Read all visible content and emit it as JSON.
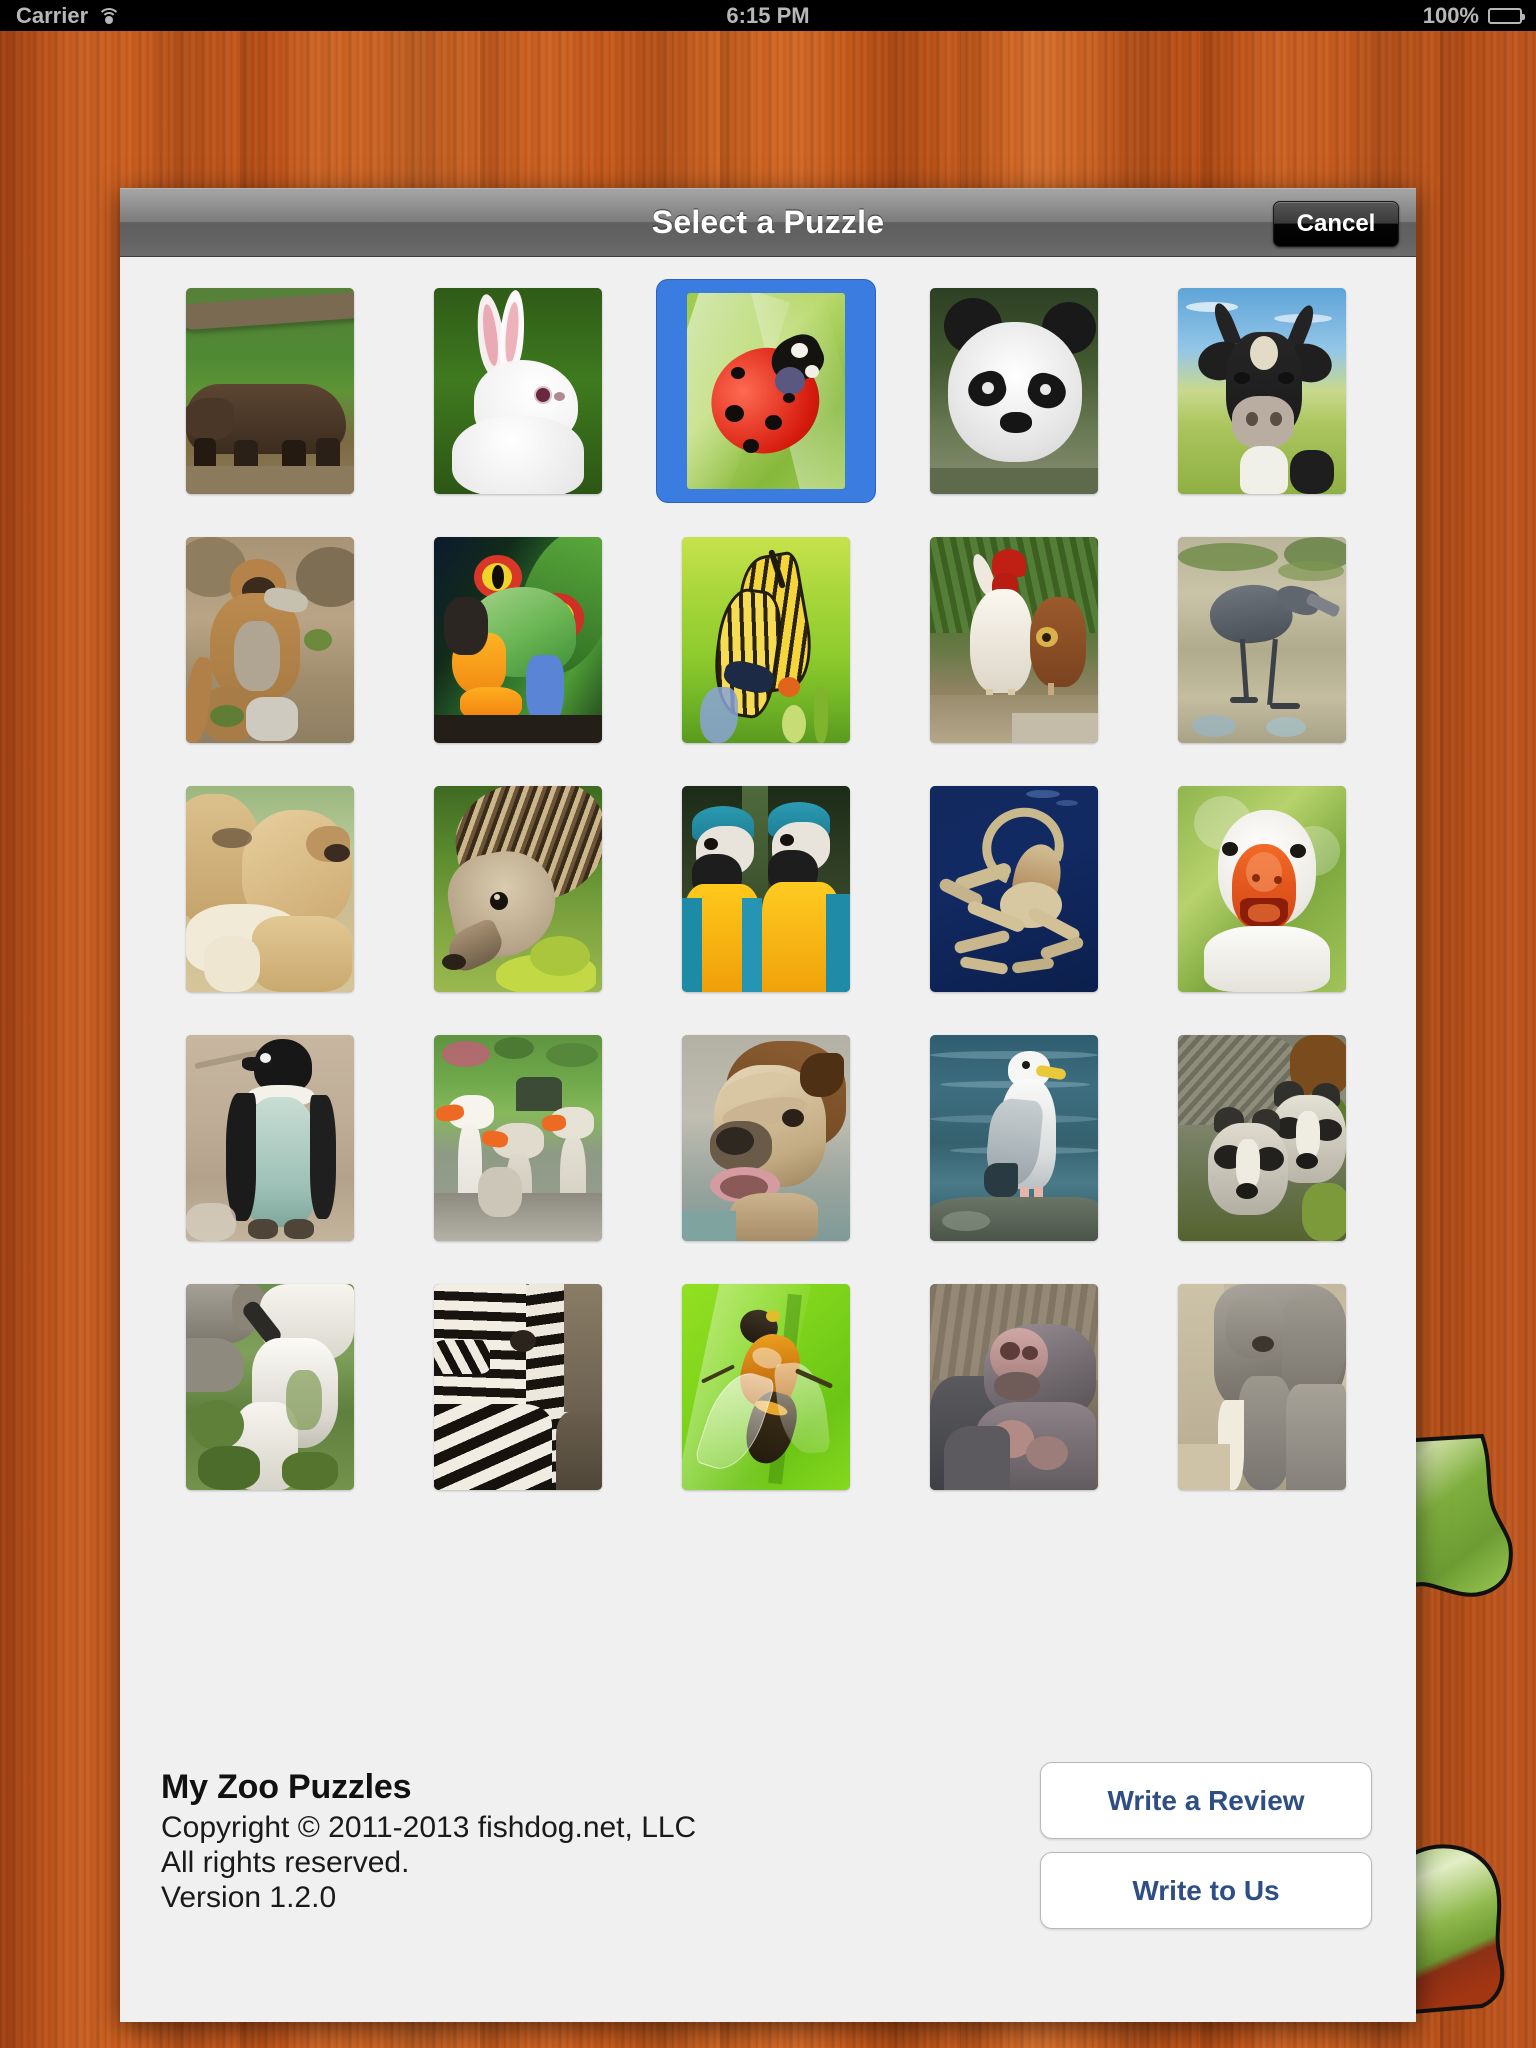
{
  "status_bar": {
    "carrier": "Carrier",
    "wifi_icon": "wifi-icon",
    "time": "6:15 PM",
    "battery_percent": "100%",
    "battery_icon": "battery-full-icon"
  },
  "modal": {
    "title": "Select a Puzzle",
    "cancel_label": "Cancel"
  },
  "grid": {
    "columns": 5,
    "rows": 5,
    "selected_index": 2,
    "items": [
      {
        "name": "bear",
        "label": "Bear"
      },
      {
        "name": "rabbit",
        "label": "Rabbit"
      },
      {
        "name": "ladybug",
        "label": "Ladybug"
      },
      {
        "name": "panda",
        "label": "Panda"
      },
      {
        "name": "cow",
        "label": "Cow"
      },
      {
        "name": "monkey",
        "label": "Monkey"
      },
      {
        "name": "frog",
        "label": "Tree Frog"
      },
      {
        "name": "butterfly",
        "label": "Butterfly"
      },
      {
        "name": "chickens",
        "label": "Rooster and Hen"
      },
      {
        "name": "heron",
        "label": "Heron"
      },
      {
        "name": "lions",
        "label": "Lion Cubs"
      },
      {
        "name": "hedgehog",
        "label": "Hedgehog"
      },
      {
        "name": "macaws",
        "label": "Macaws"
      },
      {
        "name": "octopus",
        "label": "Octopus"
      },
      {
        "name": "goose",
        "label": "Goose"
      },
      {
        "name": "penguin",
        "label": "Penguin"
      },
      {
        "name": "geese",
        "label": "Geese"
      },
      {
        "name": "bulldog",
        "label": "Bulldog"
      },
      {
        "name": "seagull",
        "label": "Seagull"
      },
      {
        "name": "raccoons",
        "label": "Raccoons"
      },
      {
        "name": "goat",
        "label": "Goat"
      },
      {
        "name": "zebra",
        "label": "Zebra"
      },
      {
        "name": "hoverfly",
        "label": "Hoverfly"
      },
      {
        "name": "hippo",
        "label": "Hippo"
      },
      {
        "name": "elephants",
        "label": "Elephants"
      }
    ]
  },
  "footer": {
    "app_name": "My Zoo Puzzles",
    "copyright": "Copyright © 2011-2013 fishdog.net, LLC",
    "rights": "All rights reserved.",
    "version": "Version 1.2.0",
    "write_review_label": "Write a Review",
    "write_to_us_label": "Write to Us"
  },
  "colors": {
    "desk_wood": "#c8571c",
    "modal_bg": "#f0f0f0",
    "titlebar_top": "#a5a5a5",
    "titlebar_bottom": "#6c6c6c",
    "selection_blue": "#3b7ce0",
    "button_text_blue": "#2f4f84",
    "status_bar_bg": "#000000",
    "status_bar_text": "#b7b7b7"
  }
}
